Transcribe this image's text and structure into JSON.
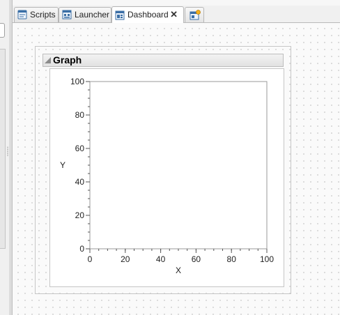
{
  "tabs": [
    {
      "label": "Scripts",
      "icon": "scripts-icon"
    },
    {
      "label": "Launcher",
      "icon": "launcher-icon"
    },
    {
      "label": "Dashboard",
      "icon": "dashboard-icon",
      "active": true,
      "close_glyph": "✕"
    }
  ],
  "new_tab": {
    "icon": "new-dashboard-icon"
  },
  "graph": {
    "title": "Graph"
  },
  "chart_data": {
    "type": "scatter",
    "title": "Graph",
    "xlabel": "X",
    "ylabel": "Y",
    "xlim": [
      0,
      100
    ],
    "ylim": [
      0,
      100
    ],
    "x_ticks": [
      0,
      20,
      40,
      60,
      80,
      100
    ],
    "y_ticks": [
      0,
      20,
      40,
      60,
      80,
      100
    ],
    "grid": false,
    "series": []
  },
  "colors": {
    "accent": "#3a6ea5",
    "panel_border": "#c6c6c6",
    "axis": "#555555"
  }
}
